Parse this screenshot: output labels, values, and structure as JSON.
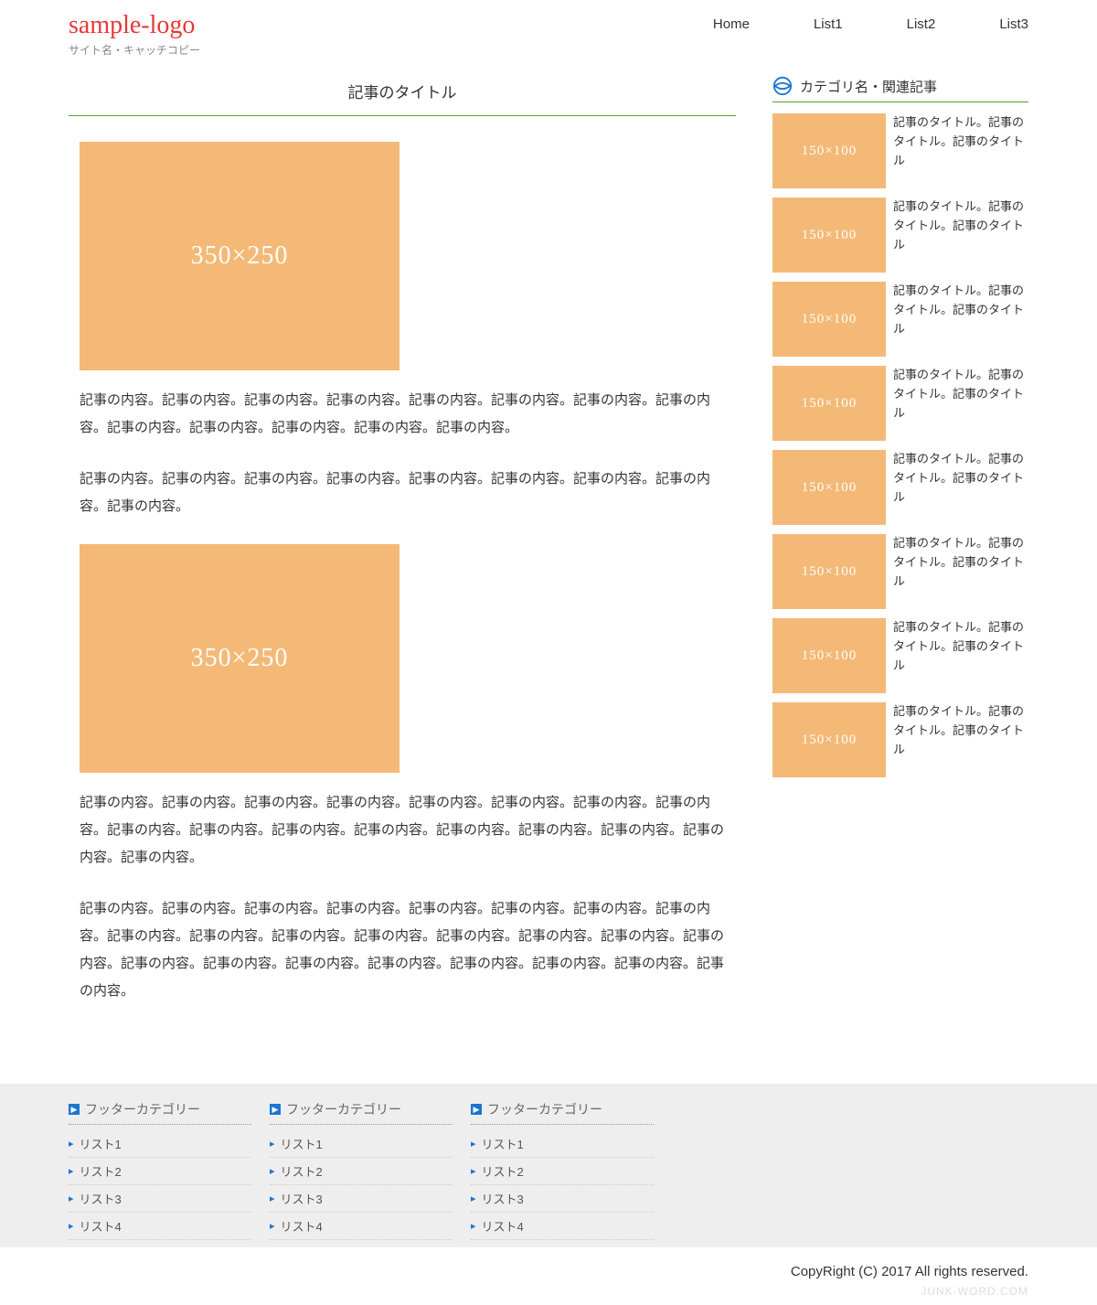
{
  "header": {
    "logo": "sample-logo",
    "tagline": "サイト名・キャッチコピー"
  },
  "nav": [
    "Home",
    "List1",
    "List2",
    "List3"
  ],
  "article": {
    "title": "記事のタイトル",
    "img1_label": "350×250",
    "img2_label": "350×250",
    "p1": "記事の内容。記事の内容。記事の内容。記事の内容。記事の内容。記事の内容。記事の内容。記事の内容。記事の内容。記事の内容。記事の内容。記事の内容。記事の内容。",
    "p2": "記事の内容。記事の内容。記事の内容。記事の内容。記事の内容。記事の内容。記事の内容。記事の内容。記事の内容。",
    "p3": "記事の内容。記事の内容。記事の内容。記事の内容。記事の内容。記事の内容。記事の内容。記事の内容。記事の内容。記事の内容。記事の内容。記事の内容。記事の内容。記事の内容。記事の内容。記事の内容。記事の内容。",
    "p4": "記事の内容。記事の内容。記事の内容。記事の内容。記事の内容。記事の内容。記事の内容。記事の内容。記事の内容。記事の内容。記事の内容。記事の内容。記事の内容。記事の内容。記事の内容。記事の内容。記事の内容。記事の内容。記事の内容。記事の内容。記事の内容。記事の内容。記事の内容。記事の内容。"
  },
  "sidebar": {
    "title": "カテゴリ名・関連記事",
    "thumb_label": "150×100",
    "items": [
      {
        "title": "記事のタイトル。記事のタイトル。記事のタイトル"
      },
      {
        "title": "記事のタイトル。記事のタイトル。記事のタイトル"
      },
      {
        "title": "記事のタイトル。記事のタイトル。記事のタイトル"
      },
      {
        "title": "記事のタイトル。記事のタイトル。記事のタイトル"
      },
      {
        "title": "記事のタイトル。記事のタイトル。記事のタイトル"
      },
      {
        "title": "記事のタイトル。記事のタイトル。記事のタイトル"
      },
      {
        "title": "記事のタイトル。記事のタイトル。記事のタイトル"
      },
      {
        "title": "記事のタイトル。記事のタイトル。記事のタイトル"
      }
    ]
  },
  "footer": {
    "col_title": "フッターカテゴリー",
    "cols": [
      [
        "リスト1",
        "リスト2",
        "リスト3",
        "リスト4"
      ],
      [
        "リスト1",
        "リスト2",
        "リスト3",
        "リスト4"
      ],
      [
        "リスト1",
        "リスト2",
        "リスト3",
        "リスト4"
      ]
    ]
  },
  "copyright": "CopyRight (C) 2017 All rights reserved.",
  "watermark": "JUNK-WORD.COM"
}
